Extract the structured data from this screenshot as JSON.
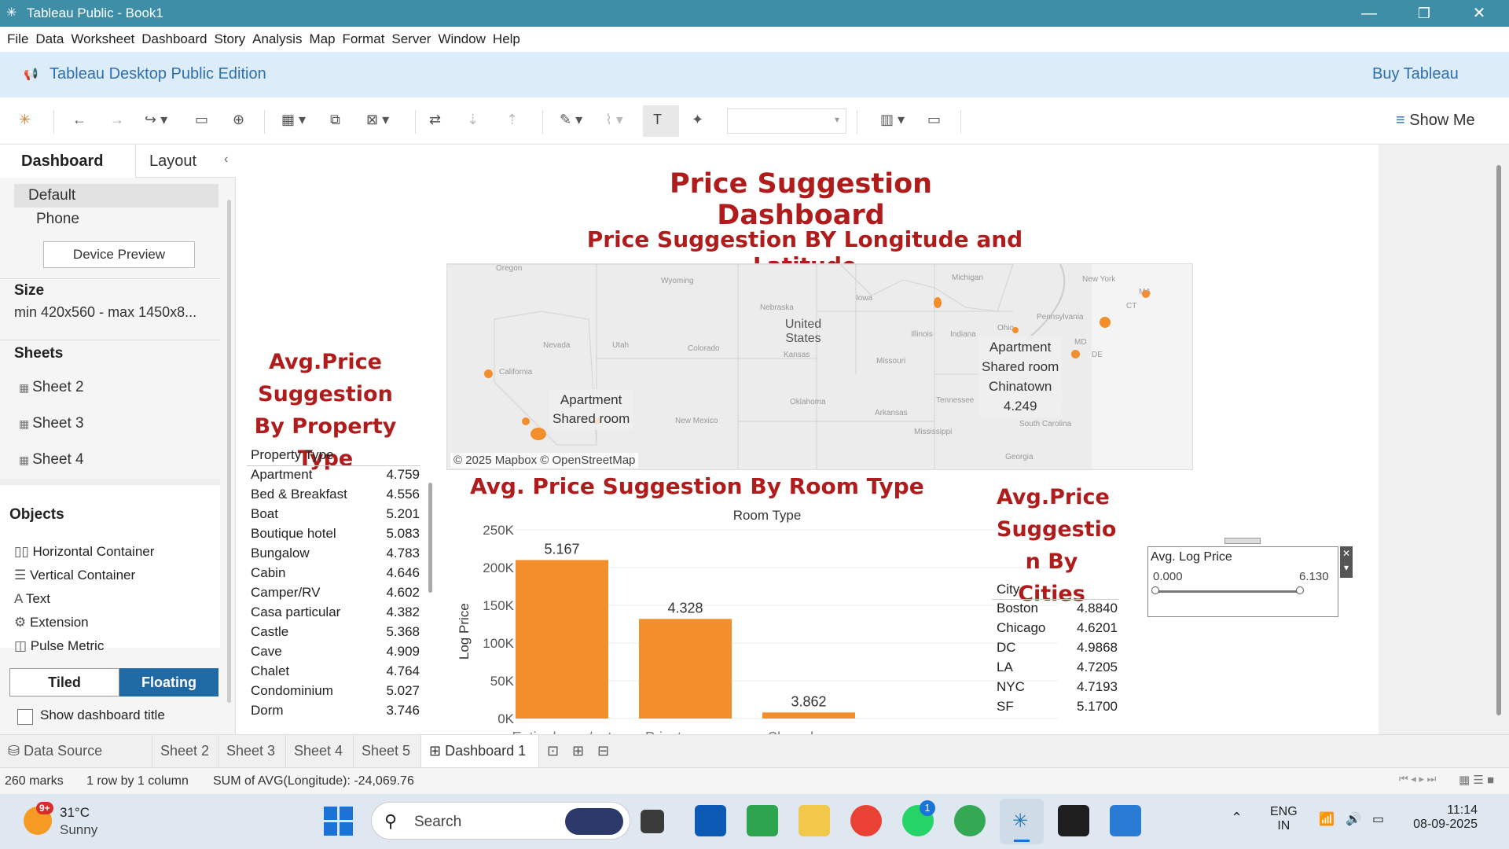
{
  "window": {
    "title": "Tableau Public - Book1",
    "minimize": "—",
    "restore": "❐",
    "close": "✕"
  },
  "menu": [
    "File",
    "Data",
    "Worksheet",
    "Dashboard",
    "Story",
    "Analysis",
    "Map",
    "Format",
    "Server",
    "Window",
    "Help"
  ],
  "banner": {
    "edition": "Tableau Desktop Public Edition",
    "buy": "Buy Tableau"
  },
  "toolbar": {
    "show_me": "Show Me",
    "icons": [
      "tableau-logo-icon",
      "back-icon",
      "forward-icon",
      "redo-icon",
      "save-icon",
      "new-datasource-icon",
      "new-sheet-icon",
      "duplicate-icon",
      "clear-icon",
      "swap-icon",
      "sort-asc-icon",
      "sort-desc-icon",
      "highlight-icon",
      "annotate-icon",
      "labels-icon",
      "pin-icon",
      "fit-icon",
      "present-icon"
    ]
  },
  "leftpanel": {
    "tabs": [
      "Dashboard",
      "Layout"
    ],
    "devices": [
      "Default",
      "Phone"
    ],
    "device_preview": "Device Preview",
    "size_label": "Size",
    "size_value": "min 420x560 - max 1450x8...",
    "sheets_label": "Sheets",
    "sheets": [
      "Sheet 2",
      "Sheet 3",
      "Sheet 4"
    ],
    "objects_label": "Objects",
    "objects": [
      "Horizontal Container",
      "Vertical Container",
      "Text",
      "Extension",
      "Pulse Metric"
    ],
    "tiled": "Tiled",
    "floating": "Floating",
    "show_title": "Show dashboard title"
  },
  "dashboard": {
    "title": "Price Suggestion Dashboard",
    "map_title": "Price Suggestion BY Longitude and Latitude",
    "map_credit": "© 2025 Mapbox © OpenStreetMap",
    "map_labels": {
      "united_states": "United States",
      "wyoming": "Wyoming",
      "nebraska": "Nebraska",
      "iowa": "Iowa",
      "michigan": "Michigan",
      "new_york": "New York",
      "pennsylvania": "Pennsylvania",
      "ohio": "Ohio",
      "illinois": "Illinois",
      "indiana": "Indiana",
      "nevada": "Nevada",
      "utah": "Utah",
      "colorado": "Colorado",
      "kansas": "Kansas",
      "missouri": "Missouri",
      "california": "California",
      "oklahoma": "Oklahoma",
      "arkansas": "Arkansas",
      "tennessee": "Tennessee",
      "new_mexico": "New Mexico",
      "mississippi": "Mississippi",
      "south_carolina": "South Carolina",
      "georgia": "Georgia",
      "oregon": "Oregon",
      "ma": "MA",
      "ct": "CT",
      "md": "MD",
      "de": "DE"
    },
    "tooltip1": [
      "Apartment",
      "Shared room"
    ],
    "tooltip2": [
      "Apartment",
      "Shared room",
      "Chinatown",
      "4.249"
    ],
    "prop_title": "Avg.Price Suggestion By Property Type",
    "prop_header": "Property Type",
    "property_types": [
      {
        "name": "Apartment",
        "value": "4.759"
      },
      {
        "name": "Bed & Breakfast",
        "value": "4.556"
      },
      {
        "name": "Boat",
        "value": "5.201"
      },
      {
        "name": "Boutique hotel",
        "value": "5.083"
      },
      {
        "name": "Bungalow",
        "value": "4.783"
      },
      {
        "name": "Cabin",
        "value": "4.646"
      },
      {
        "name": "Camper/RV",
        "value": "4.602"
      },
      {
        "name": "Casa particular",
        "value": "4.382"
      },
      {
        "name": "Castle",
        "value": "5.368"
      },
      {
        "name": "Cave",
        "value": "4.909"
      },
      {
        "name": "Chalet",
        "value": "4.764"
      },
      {
        "name": "Condominium",
        "value": "5.027"
      },
      {
        "name": "Dorm",
        "value": "3.746"
      }
    ],
    "room_title": "Avg. Price  Suggestion By Room Type",
    "city_title": [
      "Avg.Price",
      "Suggestio",
      "n By Cities"
    ],
    "city_header": "City",
    "cities": [
      {
        "name": "Boston",
        "value": "4.8840"
      },
      {
        "name": "Chicago",
        "value": "4.6201"
      },
      {
        "name": "DC",
        "value": "4.9868"
      },
      {
        "name": "LA",
        "value": "4.7205"
      },
      {
        "name": "NYC",
        "value": "4.7193"
      },
      {
        "name": "SF",
        "value": "5.1700"
      }
    ],
    "filter": {
      "title": "Avg. Log Price",
      "min": "0.000",
      "max": "6.130"
    }
  },
  "chart_data": {
    "type": "bar",
    "title": "Avg. Price  Suggestion By Room Type",
    "xlabel": "Room Type",
    "ylabel": "Log Price",
    "categories": [
      "Entire home/apt",
      "Private room",
      "Shared room"
    ],
    "values": [
      210000,
      132000,
      8000
    ],
    "data_labels": [
      "5.167",
      "4.328",
      "3.862"
    ],
    "yticks": [
      "0K",
      "50K",
      "100K",
      "150K",
      "200K",
      "250K"
    ],
    "ylim": [
      0,
      250000
    ],
    "color": "#f28e2b"
  },
  "tabs": {
    "data_source": "Data Source",
    "sheets": [
      "Sheet 2",
      "Sheet 3",
      "Sheet 4",
      "Sheet 5"
    ],
    "active": "Dashboard 1"
  },
  "status": {
    "marks": "260 marks",
    "rows": "1 row by 1 column",
    "sum": "SUM of AVG(Longitude): -24,069.76"
  },
  "taskbar": {
    "weather_temp": "31°C",
    "weather_desc": "Sunny",
    "weather_badge": "9+",
    "search": "Search",
    "lang1": "ENG",
    "lang2": "IN",
    "time": "11:14",
    "date": "08-09-2025",
    "whatsapp_badge": "1"
  }
}
